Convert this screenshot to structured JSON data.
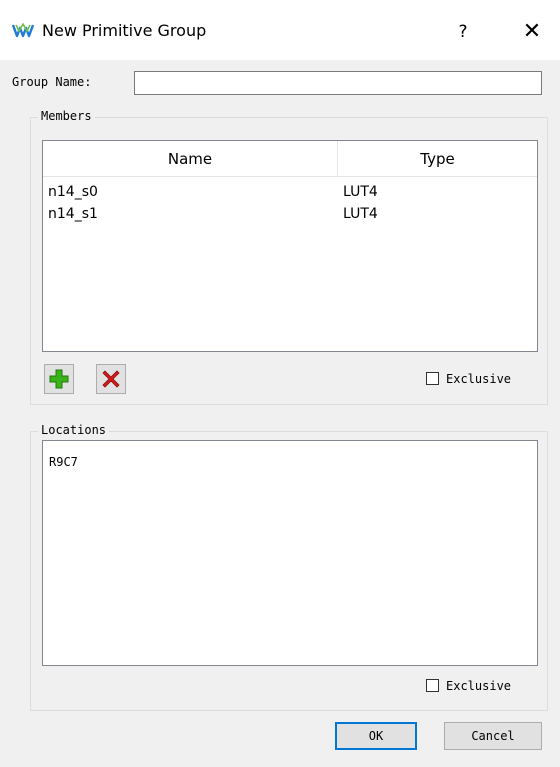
{
  "window": {
    "title": "New Primitive Group",
    "help_label": "?",
    "close_label": "✕",
    "app_icon": "gowin-logo-icon"
  },
  "group_name": {
    "label": "Group Name:",
    "value": "",
    "placeholder": ""
  },
  "members": {
    "legend": "Members",
    "columns": [
      "Name",
      "Type"
    ],
    "rows": [
      {
        "name": "n14_s0",
        "type": "LUT4"
      },
      {
        "name": "n14_s1",
        "type": "LUT4"
      }
    ],
    "add_icon": "plus-icon",
    "remove_icon": "delete-x-icon",
    "exclusive_label": "Exclusive",
    "exclusive_checked": false
  },
  "locations": {
    "legend": "Locations",
    "value": "R9C7",
    "exclusive_label": "Exclusive",
    "exclusive_checked": false
  },
  "buttons": {
    "ok": "OK",
    "cancel": "Cancel"
  },
  "colors": {
    "accent": "#0078d7",
    "add_green": "#3cb21a",
    "remove_red": "#d41a1a"
  }
}
